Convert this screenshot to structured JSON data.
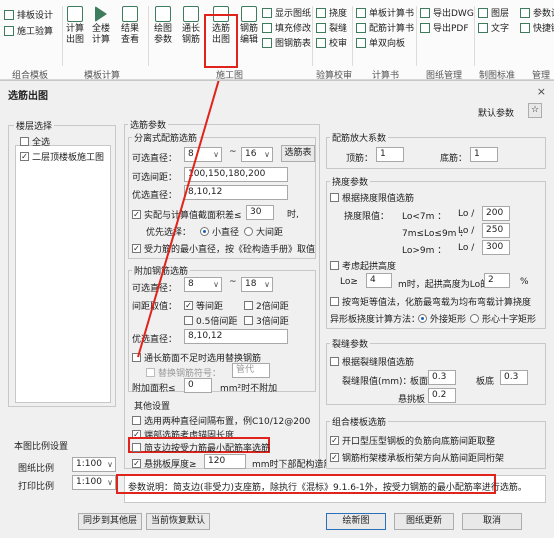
{
  "ribbon": {
    "b_paibansheji": "排板设计",
    "b_shigongyansuan": "施工验算",
    "b_jisuan": "计算\n出图",
    "b_quanzhi": "全楼\n计算",
    "b_jieguo": "结果\n查看",
    "b_huitu": "绘图\n参数",
    "b_tongchang": "通长\n钢筋",
    "b_xuanjin": "选筋\n出图",
    "b_gangjin": "钢筋\n编辑",
    "b_xianshitumian": "显示图纸",
    "b_tianchongxiugai": "填充修改",
    "b_tumianganjin": "图钢筋表",
    "b_naodu": "挠度",
    "b_liefeng": "裂缝",
    "b_xiaohe": "校审",
    "b_danbanjisuanshu": "单板计算书",
    "b_peijinjisuanshu": "配筋计算书",
    "b_danshuangxiang": "单双向板",
    "b_daochudwg": "导出DWG",
    "b_daochupdf": "导出PDF",
    "b_tuceng": "图层",
    "b_wenzi": "文字",
    "b_canshu": "参数设",
    "b_kuaijie": "快捷键",
    "g_zuhemuban": "组合模板",
    "g_mubanjisuan": "模板计算",
    "g_shigongtu": "施工图",
    "g_yansuanjiaohe": "验算校审",
    "g_jisuanshu": "计算书",
    "g_tuzhiguanli": "图纸管理",
    "g_zhitubiaozhun": "制图标准",
    "g_guanli": "管理"
  },
  "dialog": {
    "title": "选筋出图",
    "close": "×",
    "default_params": "默认参数",
    "storey_select": {
      "legend": "楼层选择",
      "all": "全选",
      "floor2": "二层顶楼板施工图"
    },
    "scale": {
      "legend": "本图比例设置",
      "drawing_label": "图纸比例",
      "drawing_value": "1:100",
      "print_label": "打印比例",
      "print_value": "1:100"
    },
    "rebar": {
      "legend": "选筋参数",
      "distributed": {
        "legend": "分离式配筋选筋",
        "dia_label": "可选直径：",
        "dia_min": "8",
        "dia_max": "16",
        "tilde": "~",
        "dia_table_button": "选筋表",
        "spacing_label": "可选间距：",
        "spacing_value": "100,150,180,200",
        "pref_dia_label": "优选直径：",
        "pref_dia_value": "8,10,12",
        "area_check": "实配与计算值截面积差≤",
        "area_value": "30",
        "area_unit": "时,",
        "pref_label": "优先选择：",
        "small_dia": "小直径",
        "large_dia": "大间距",
        "min_dia_check": "受力筋的最小直径，按《砼构造手册》取值"
      },
      "additional": {
        "legend": "附加钢筋选筋",
        "dia_label": "可选直径：",
        "dia_min": "8",
        "dia_max": "18",
        "tilde": "~",
        "spacing_label": "间距取值：",
        "eq_spacing": "等间距",
        "x2_spacing": "2倍间距",
        "x05_spacing": "0.5倍间距",
        "x3_spacing": "3倍间距",
        "pref_dia_label": "优选直径：",
        "pref_dia_value": "8,10,12",
        "long_rebar": "通长筋面不足时选用替换钢筋",
        "replace_rebar": "替换钢筋符号：",
        "replace_value": "管代",
        "area_label": "附加面积≤",
        "area_value": "0",
        "area_unit": "mm²时不附加"
      },
      "other": {
        "legend": "其他设置",
        "opt1": "选用两种直径间隔布置，例C10/12@200",
        "opt2": "端部选筋考虑锚固长度",
        "opt3": "简支边按受力筋最小配筋率选筋",
        "opt4": "悬挑板厚度≥",
        "opt4_value": "120",
        "opt4_tail": "mm时下部配构造筋"
      }
    },
    "amplify": {
      "legend": "配筋放大系数",
      "top_label": "顶筋：",
      "top_value": "1",
      "bottom_label": "底筋：",
      "bottom_value": "1"
    },
    "deflection": {
      "legend": "挠度参数",
      "limit_check": "根据挠度限值选筋",
      "limit_label": "挠度限值：",
      "r1_cond": "Lo<7m ：",
      "r1_frac": "Lo  /",
      "r1_val": "200",
      "r2_cond": "7m≤Lo≤9m ：",
      "r2_frac": "Lo  /",
      "r2_val": "250",
      "r3_cond": "Lo>9m ：",
      "r3_frac": "Lo  /",
      "r3_val": "300",
      "camber_check": "考虑起拱高度",
      "camber_a": "Lo≥",
      "camber_a_val": "4",
      "camber_b": "m时，起拱高度为Lo的",
      "camber_b_val": "2",
      "camber_c": "%",
      "equal_stiff": "按弯矩等值法，化筋最弯载为均布弯载计算挠度",
      "special_label": "异形板挠度计算方法：",
      "ext_rect": "外接矩形",
      "cross_rect": "形心十字矩形"
    },
    "crack": {
      "legend": "裂缝参数",
      "limit_check": "根据裂缝限值选筋",
      "limit_label": "裂缝限值(mm)：",
      "plate_label": "板面",
      "plate_value": "0.3",
      "bottom_label": "板底",
      "bottom_value": "0.3",
      "cant_label": "悬挑板",
      "cant_value": "0.2"
    },
    "combined": {
      "legend": "组合楼板选筋",
      "opt1": "开口型压型钢板的负筋向底筋间距取整",
      "opt2": "钢筋桁架楼承板桁架方向从筋间距同桁架"
    },
    "description": "参数说明：简支边(非受力)支座筋，除执行《混标》9.1.6-1外，按受力钢筋的最小配筋率进行选筋。",
    "buttons": {
      "sync_floors": "同步到其他层",
      "restore_default": "当前恢复默认",
      "draw": "绘新图",
      "update": "图纸更新",
      "cancel": "取消"
    }
  }
}
